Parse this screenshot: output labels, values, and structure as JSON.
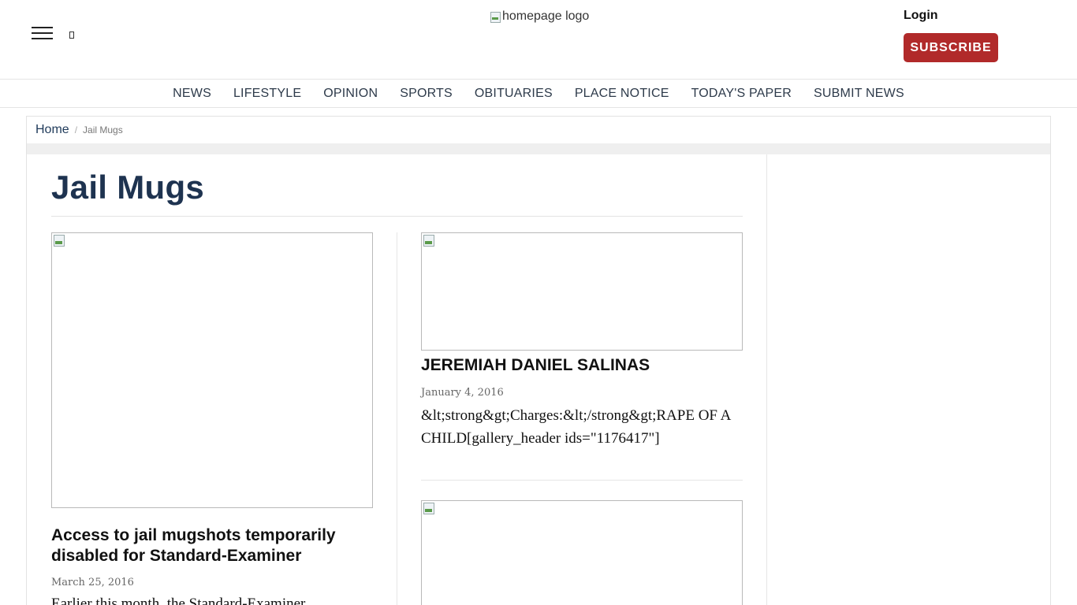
{
  "header": {
    "logo_alt": "homepage logo",
    "login_label": "Login",
    "subscribe_label": "SUBSCRIBE",
    "subscribe_color": "#b12a2a"
  },
  "nav": {
    "items": [
      "NEWS",
      "LIFESTYLE",
      "OPINION",
      "SPORTS",
      "OBITUARIES",
      "PLACE NOTICE",
      "TODAY'S PAPER",
      "SUBMIT NEWS"
    ]
  },
  "breadcrumb": {
    "home": "Home",
    "separator": "/",
    "current": "Jail Mugs"
  },
  "main": {
    "title": "Jail Mugs",
    "title_color": "#1e3350",
    "articles": [
      {
        "headline": "Access to jail mugshots temporarily disabled for Standard-Examiner",
        "date": "March 25, 2016",
        "excerpt": "Earlier this month, the Standard-Examiner"
      },
      {
        "headline": "JEREMIAH DANIEL SALINAS",
        "date": "January 4, 2016",
        "excerpt": "&lt;strong&gt;Charges:&lt;/strong&gt;RAPE OF A CHILD[gallery_header ids=\"1176417\"]"
      }
    ]
  },
  "icons": {
    "menu": "hamburger-menu-icon",
    "search": "search-icon",
    "broken_image": "broken-image-icon"
  }
}
